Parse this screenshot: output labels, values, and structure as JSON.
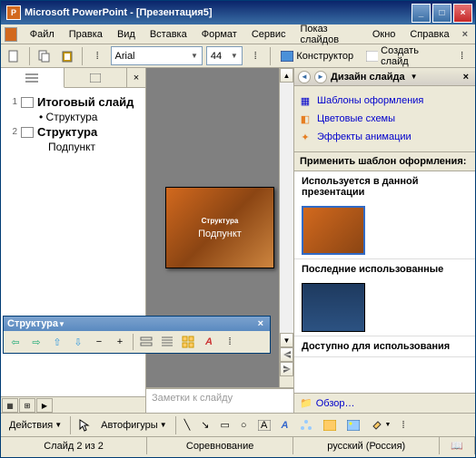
{
  "title": "Microsoft PowerPoint - [Презентация5]",
  "menu": {
    "file": "Файл",
    "edit": "Правка",
    "view": "Вид",
    "insert": "Вставка",
    "format": "Формат",
    "tools": "Сервис",
    "slideshow": "Показ слайдов",
    "window": "Окно",
    "help": "Справка"
  },
  "toolbar": {
    "font": "Arial",
    "size": "44",
    "designer": "Конструктор",
    "newslide": "Создать слайд"
  },
  "outline": {
    "slides": [
      {
        "num": "1",
        "title": "Итоговый слайд",
        "bullets": [
          "Структура"
        ]
      },
      {
        "num": "2",
        "title": "Структура",
        "subs": [
          "Подпункт"
        ]
      }
    ]
  },
  "slide": {
    "title": "Структура",
    "body": "Подпункт"
  },
  "notes_placeholder": "Заметки к слайду",
  "floatwin": {
    "title": "Структура"
  },
  "taskpane": {
    "title": "Дизайн слайда",
    "links": {
      "templates": "Шаблоны оформления",
      "colors": "Цветовые схемы",
      "anim": "Эффекты анимации"
    },
    "apply_label": "Применить шаблон оформления:",
    "groups": {
      "used": "Используется в данной презентации",
      "recent": "Последние использованные",
      "avail": "Доступно для использования"
    },
    "browse": "Обзор…"
  },
  "drawbar": {
    "actions": "Действия",
    "autoshapes": "Автофигуры"
  },
  "status": {
    "slide": "Слайд 2 из 2",
    "design": "Соревнование",
    "lang": "русский (Россия)"
  }
}
